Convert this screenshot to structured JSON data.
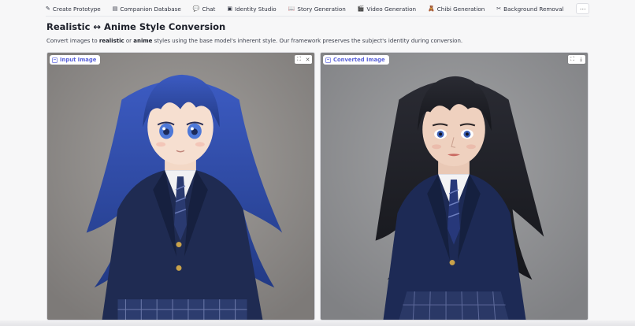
{
  "tabs": [
    {
      "icon": "✎",
      "icon_name": "pencil-icon",
      "label": "Create Prototype"
    },
    {
      "icon": "▤",
      "icon_name": "database-icon",
      "label": "Companion Database"
    },
    {
      "icon": "💬",
      "icon_name": "chat-bubble-icon",
      "label": "Chat"
    },
    {
      "icon": "▣",
      "icon_name": "id-card-icon",
      "label": "Identity Studio"
    },
    {
      "icon": "📖",
      "icon_name": "book-icon",
      "label": "Story Generation"
    },
    {
      "icon": "🎬",
      "icon_name": "clapper-icon",
      "label": "Video Generation"
    },
    {
      "icon": "🧸",
      "icon_name": "chibi-icon",
      "label": "Chibi Generation"
    },
    {
      "icon": "✂",
      "icon_name": "scissors-icon",
      "label": "Background Removal"
    }
  ],
  "more_label": "⋯",
  "page": {
    "title": "Realistic ↔ Anime Style Conversion",
    "desc_1": "Convert images to ",
    "desc_bold_1": "realistic",
    "desc_2": " or ",
    "desc_bold_2": "anime",
    "desc_3": " styles using the base model's inherent style. Our framework preserves the subject's identity during conversion."
  },
  "panels": {
    "input": {
      "label": "Input Image"
    },
    "output": {
      "label": "Converted Image"
    }
  },
  "colors": {
    "accent": "#5a62d8",
    "hair_anime": "#2f4aa0",
    "hair_real": "#1b1c22",
    "blazer": "#1f2b52"
  }
}
